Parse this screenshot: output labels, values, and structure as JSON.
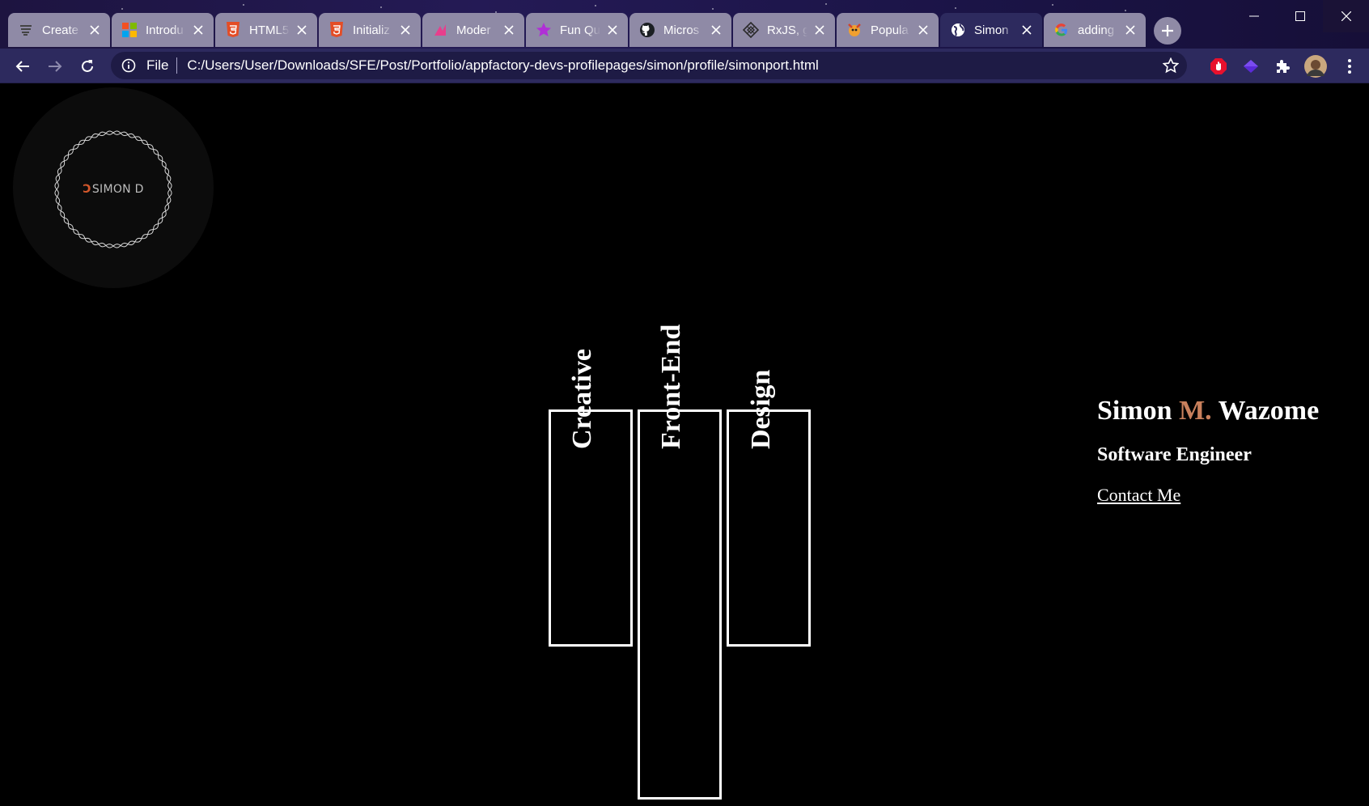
{
  "browser": {
    "tabs": [
      {
        "label": "Create",
        "icon": "stack-icon",
        "active": false
      },
      {
        "label": "Introdu",
        "icon": "microsoft-icon",
        "active": false
      },
      {
        "label": "HTML5",
        "icon": "html5-icon",
        "active": false
      },
      {
        "label": "Initializ",
        "icon": "html5-icon",
        "active": false
      },
      {
        "label": "Moder",
        "icon": "chart-icon",
        "active": false
      },
      {
        "label": "Fun Qu",
        "icon": "star-icon",
        "active": false
      },
      {
        "label": "Micros",
        "icon": "github-icon",
        "active": false
      },
      {
        "label": "RxJS, g",
        "icon": "rxjs-icon",
        "active": false
      },
      {
        "label": "Popula",
        "icon": "fox-icon",
        "active": false
      },
      {
        "label": "Simon",
        "icon": "globe-icon",
        "active": true
      },
      {
        "label": "adding",
        "icon": "google-icon",
        "active": false
      }
    ],
    "address": {
      "scheme": "File",
      "url": "C:/Users/User/Downloads/SFE/Post/Portfolio/appfactory-devs-profilepages/simon/profile/simonport.html"
    }
  },
  "page": {
    "logo": {
      "mark": "Ↄ",
      "text": "SIMON D"
    },
    "pillars": [
      {
        "label": "Creative"
      },
      {
        "label": "Front-End"
      },
      {
        "label": "Design"
      }
    ],
    "hero": {
      "first_name": "Simon",
      "middle_initial": "M.",
      "last_name": "Wazome",
      "title": "Software Engineer",
      "contact_link": "Contact Me"
    }
  },
  "colors": {
    "accent": "#c9805c",
    "logo_mark": "#d3572b",
    "chrome": "#2d2a5e",
    "page_bg": "#000000"
  }
}
